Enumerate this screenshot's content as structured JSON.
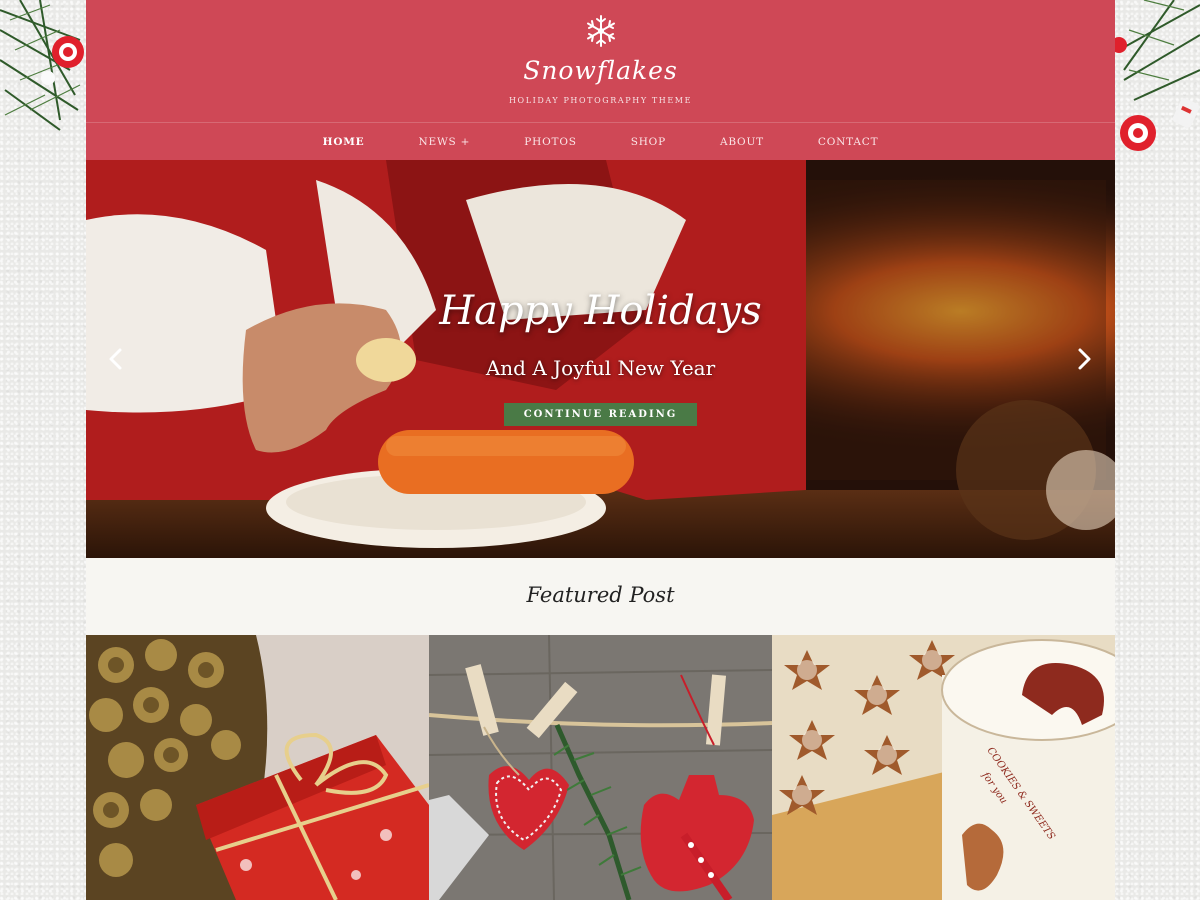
{
  "site": {
    "title": "Snowflakes",
    "tagline": "HOLIDAY PHOTOGRAPHY THEME",
    "accent": "#cf4856"
  },
  "nav": {
    "items": [
      {
        "label": "HOME",
        "active": true
      },
      {
        "label": "NEWS +",
        "active": false
      },
      {
        "label": "PHOTOS",
        "active": false
      },
      {
        "label": "SHOP",
        "active": false
      },
      {
        "label": "ABOUT",
        "active": false
      },
      {
        "label": "CONTACT",
        "active": false
      }
    ]
  },
  "hero": {
    "title": "Happy Holidays",
    "subtitle": "And A Joyful New Year",
    "button_label": "CONTINUE READING",
    "button_color": "#4a7a46",
    "prev_icon": "chevron-left-icon",
    "next_icon": "chevron-right-icon"
  },
  "featured": {
    "heading": "Featured Post",
    "cards": [
      {
        "image": "gift-and-pinecones-photo"
      },
      {
        "image": "clothespin-ornaments-photo"
      },
      {
        "image": "star-cookies-tin-photo"
      }
    ]
  }
}
